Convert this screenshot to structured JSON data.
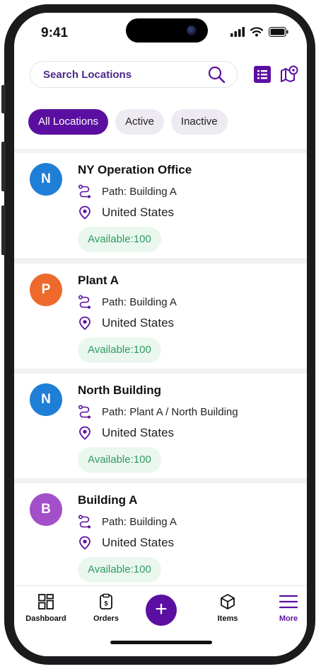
{
  "status_bar": {
    "time": "9:41"
  },
  "header": {
    "search": {
      "placeholder": "Search Locations",
      "icon": "search-icon"
    },
    "list_view_icon": "list-view-icon",
    "map_view_icon": "map-view-icon"
  },
  "filters": [
    {
      "label": "All Locations",
      "selected": true
    },
    {
      "label": "Active",
      "selected": false
    },
    {
      "label": "Inactive",
      "selected": false
    }
  ],
  "locations": [
    {
      "initial": "N",
      "avatar_color": "#1f7fd6",
      "name": "NY Operation Office",
      "path": "Path: Building A",
      "country": "United States",
      "availability": "Available:100"
    },
    {
      "initial": "P",
      "avatar_color": "#ee6a2c",
      "name": "Plant A",
      "path": "Path: Building A",
      "country": "United States",
      "availability": "Available:100"
    },
    {
      "initial": "N",
      "avatar_color": "#1f7fd6",
      "name": "North Building",
      "path": "Path: Plant A / North Building",
      "country": "United States",
      "availability": "Available:100"
    },
    {
      "initial": "B",
      "avatar_color": "#a34fc9",
      "name": "Building A",
      "path": "Path: Building A",
      "country": "United States",
      "availability": "Available:100"
    }
  ],
  "bottom_nav": {
    "items": [
      {
        "label": "Dashboard",
        "icon": "dashboard-icon"
      },
      {
        "label": "Orders",
        "icon": "orders-icon"
      },
      {
        "label": "Items",
        "icon": "items-icon"
      },
      {
        "label": "More",
        "icon": "menu-icon",
        "active": true
      }
    ],
    "add_button": "+"
  },
  "colors": {
    "accent": "#5b0fa0",
    "badge_text": "#2f9b63",
    "badge_bg": "#eaf7ef"
  }
}
